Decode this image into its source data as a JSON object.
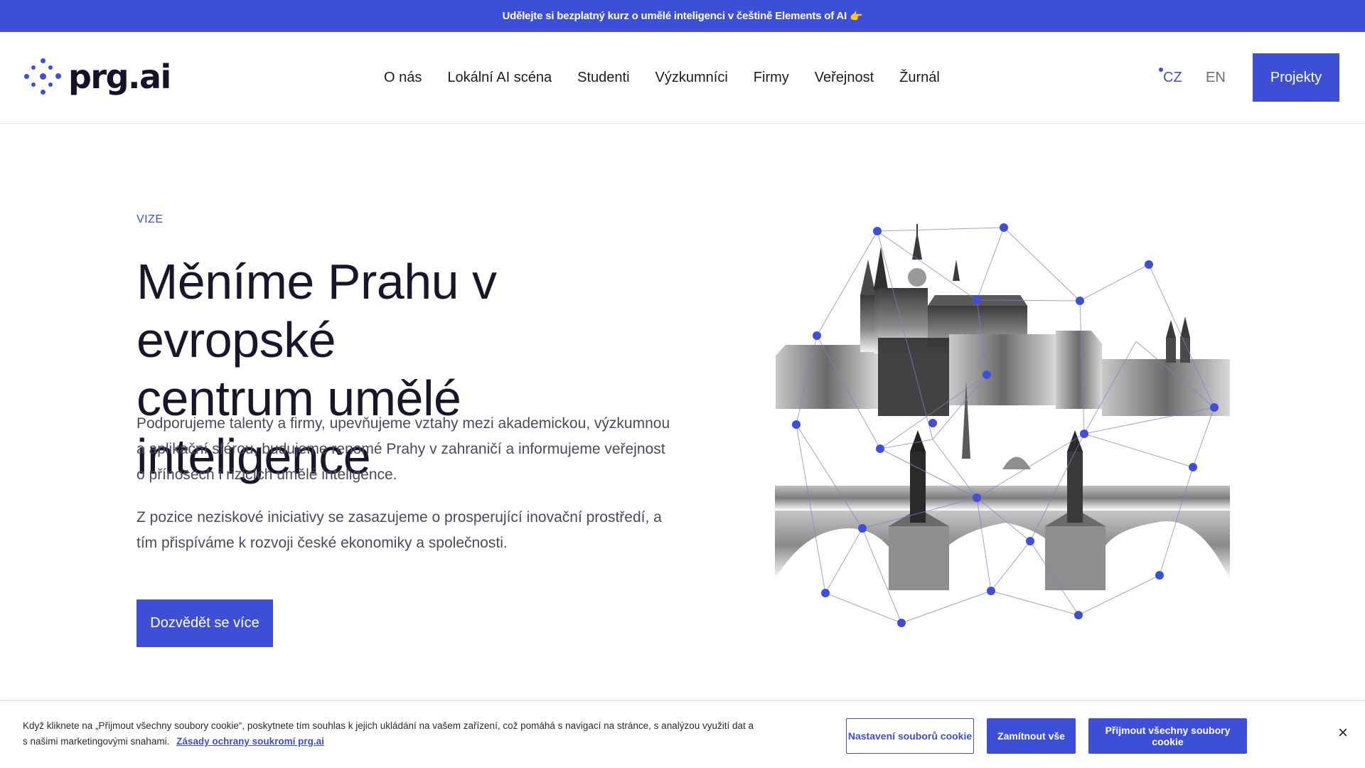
{
  "banner": {
    "text": "Udělejte si bezplatný kurz o umělé inteligenci v češtině Elements of AI",
    "emoji": "👉"
  },
  "header": {
    "logo_text": "prg.ai",
    "nav": [
      "O nás",
      "Lokální AI scéna",
      "Studenti",
      "Výzkumníci",
      "Firmy",
      "Veřejnost",
      "Žurnál"
    ],
    "lang_cz": "CZ",
    "lang_en": "EN",
    "projects_button": "Projekty"
  },
  "hero": {
    "eyebrow": "VIZE",
    "title_line1": "Měníme Prahu v evropské",
    "title_line2": "centrum umělé inteligence",
    "paragraph1": "Podporujeme talenty a firmy, upevňujeme vztahy mezi akademickou, výzkumnou a aplikační sférou, budujeme renomé Prahy v zahraničí a informujeme veřejnost o přínosech i rizicích umělé inteligence.",
    "paragraph2": "Z pozice neziskové iniciativy se zasazujeme o prosperující inovační prostředí, a tím přispíváme k rozvoji české ekonomiky a společnosti.",
    "cta": "Dozvědět se více"
  },
  "cookie": {
    "text": "Když kliknete na „Přijmout všechny soubory cookie“, poskytnete tím souhlas k jejich ukládání na vašem zařízení, což pomáhá s navigací na stránce, s analýzou využití dat a s našimi marketingovými snahami.",
    "policy_link": "Zásady ochrany soukromí prg.ai",
    "settings_button": "Nastavení souborů cookie",
    "reject_button": "Zamítnout vše",
    "accept_button": "Přijmout všechny soubory cookie",
    "close": "×"
  },
  "colors": {
    "brand": "#3d4ed7",
    "text": "#17172b",
    "muted": "#4a4a5e"
  }
}
